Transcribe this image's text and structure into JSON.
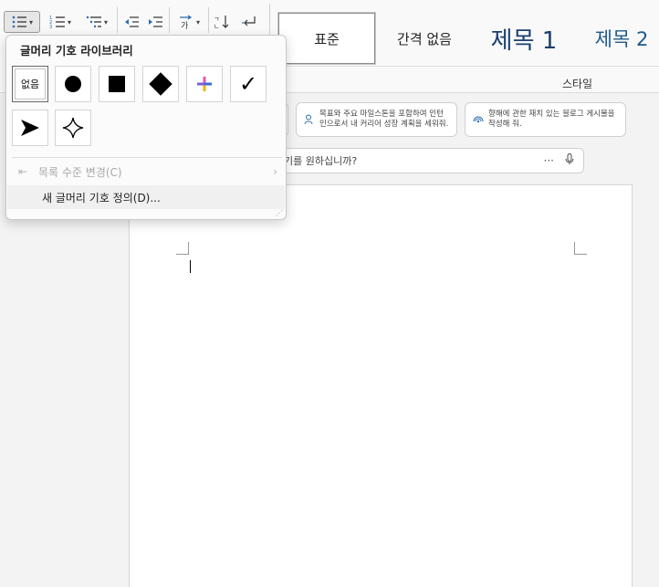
{
  "ribbon": {
    "styles": {
      "standard": "표준",
      "no_spacing": "간격 없음",
      "heading1": "제목 1",
      "heading2": "제목 2",
      "group_label": "스타일"
    }
  },
  "copilot": {
    "card1_text": "",
    "card2_text": "목표와 주요 마일스톤을 포함하여 인턴인으로서 내 커리어 성장 계획을 세워줘.",
    "card3_text": "향해에 관한 재치 있는 블로그 게시물을 작성해 줘.",
    "prompt_text": "기를 원하십니까?",
    "prompt_more": "···"
  },
  "bullet_library": {
    "title": "글머리 기호 라이브러리",
    "none_label": "없음",
    "items": [
      "none",
      "filled-circle",
      "filled-square",
      "filled-diamond",
      "color-cross",
      "checkmark",
      "arrowhead",
      "four-point-star"
    ],
    "selected": "none",
    "menu": {
      "change_level": "목록 수준 변경(C)",
      "define_new": "새 글머리 기호 정의(D)..."
    }
  }
}
